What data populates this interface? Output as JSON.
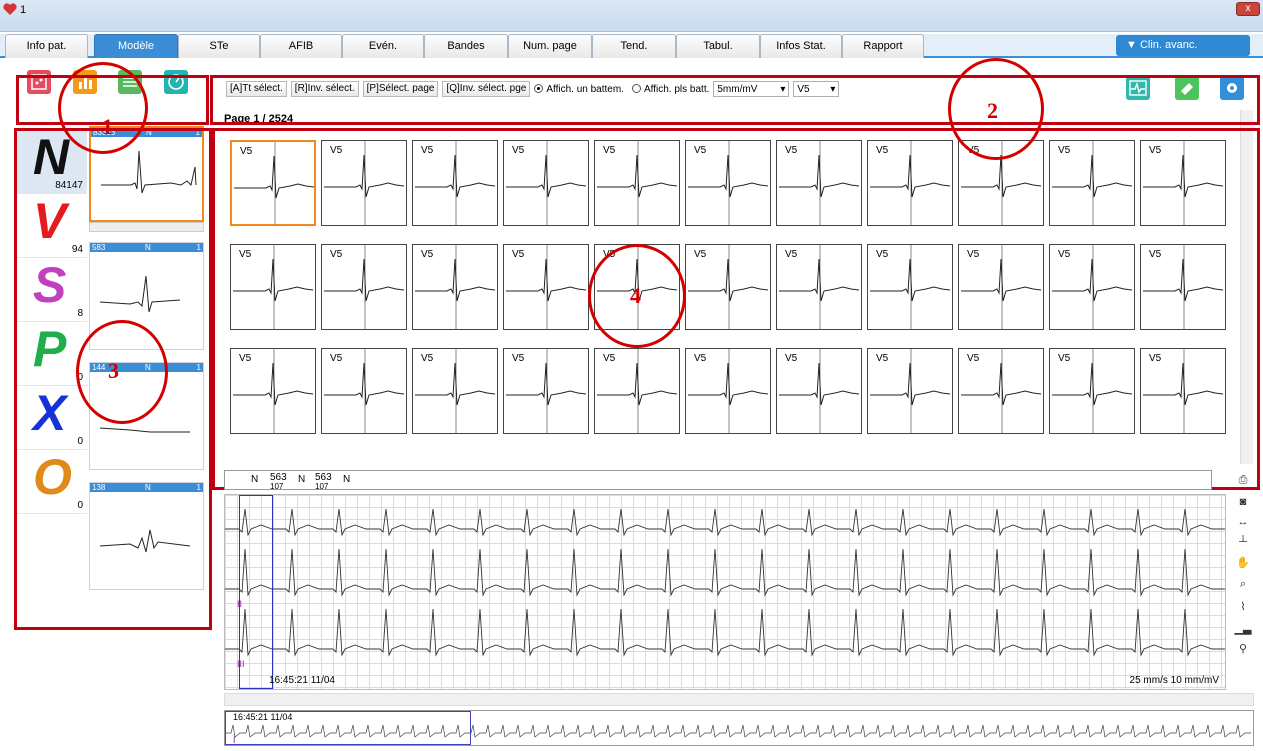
{
  "window": {
    "title": "1",
    "close_label": "x"
  },
  "tabs": [
    {
      "label": "Info pat.",
      "active": false
    },
    {
      "label": "Modèle",
      "active": true
    },
    {
      "label": "STe",
      "active": false
    },
    {
      "label": "AFIB",
      "active": false
    },
    {
      "label": "Evén.",
      "active": false
    },
    {
      "label": "Bandes",
      "active": false
    },
    {
      "label": "Num. page",
      "active": false
    },
    {
      "label": "Tend.",
      "active": false
    },
    {
      "label": "Tabul.",
      "active": false
    },
    {
      "label": "Infos Stat.",
      "active": false
    },
    {
      "label": "Rapport",
      "active": false
    }
  ],
  "clin_button": "▼ Clin. avanc.",
  "toolbar": {
    "select_all": "[A]Tt sélect.",
    "invert_select": "[R]Inv. sélect.",
    "select_page": "[P]Sélect. page",
    "invert_page": "[Q]Inv. sélect. pge",
    "radio_one": "Affich. un battem.",
    "radio_multi": "Affich. pls batt.",
    "gain_value": "5mm/mV",
    "lead_value": "V5"
  },
  "page_label": "Page 1 / 2524",
  "beat_lead": "V5",
  "classes": [
    {
      "letter": "N",
      "count": "84147",
      "color": "#111111"
    },
    {
      "letter": "V",
      "count": "94",
      "color": "#e41a1c"
    },
    {
      "letter": "S",
      "count": "8",
      "color": "#c040c0"
    },
    {
      "letter": "P",
      "count": "0",
      "color": "#1fae4b"
    },
    {
      "letter": "X",
      "count": "0",
      "color": "#1533d8"
    },
    {
      "letter": "O",
      "count": "0",
      "color": "#e08a1a"
    }
  ],
  "templates": [
    {
      "count": "83333",
      "type": "N",
      "idx": "1"
    },
    {
      "count": "583",
      "type": "N",
      "idx": "1"
    },
    {
      "count": "144",
      "type": "N",
      "idx": "1"
    },
    {
      "count": "138",
      "type": "N",
      "idx": "1"
    }
  ],
  "annotations": [
    "1",
    "2",
    "3",
    "4"
  ],
  "strip": {
    "beat_labels": [
      "N",
      "563",
      "N",
      "563",
      "N"
    ],
    "beat_sublabels": [
      "107",
      "107"
    ],
    "leads": [
      "I",
      "II",
      "III"
    ],
    "timestamp": "16:45:21 11/04",
    "speed": "25 mm/s 10 mm/mV"
  },
  "overview": {
    "timestamp": "16:45:21 11/04",
    "lead": "I"
  }
}
